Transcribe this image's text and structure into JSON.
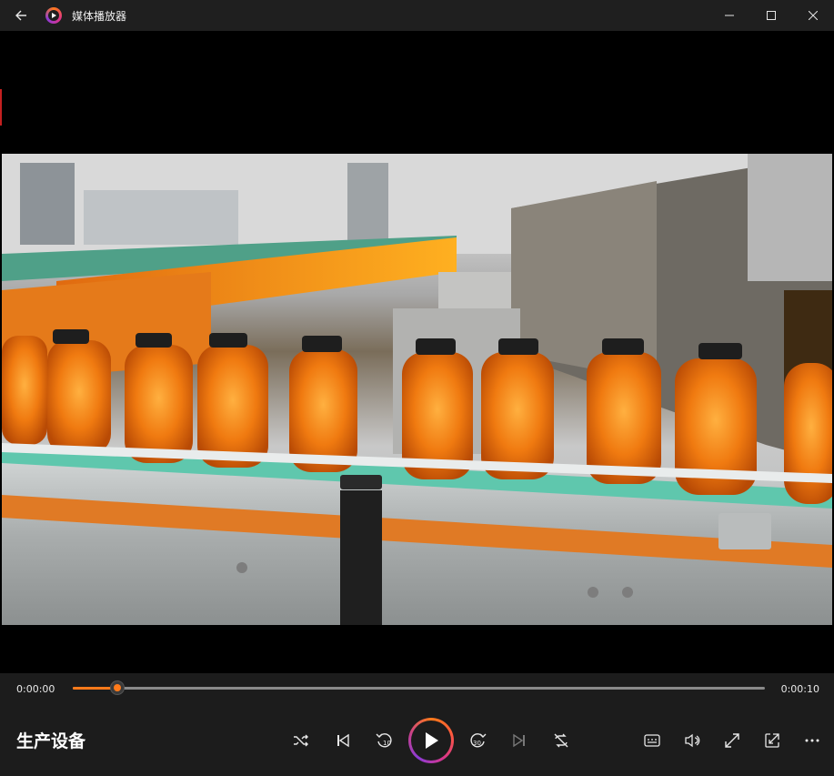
{
  "window": {
    "app_title": "媒体播放器",
    "icons": {
      "back": "arrow-left-icon",
      "minimize": "minimize-icon",
      "maximize": "maximize-icon",
      "close": "close-icon"
    }
  },
  "player": {
    "current_time": "0:00:00",
    "duration": "0:00:10",
    "progress_fraction": 0.065,
    "media_title": "生产设备",
    "accent_color": "#ff7a1a",
    "controls": [
      {
        "name": "shuffle",
        "icon": "shuffle-icon"
      },
      {
        "name": "previous",
        "icon": "skip-previous-icon"
      },
      {
        "name": "skip-back",
        "icon": "rewind-10-icon",
        "label": "10"
      },
      {
        "name": "play",
        "icon": "play-icon"
      },
      {
        "name": "skip-forward",
        "icon": "forward-30-icon",
        "label": "30"
      },
      {
        "name": "next",
        "icon": "skip-next-icon",
        "disabled": true
      },
      {
        "name": "repeat",
        "icon": "repeat-off-icon"
      }
    ],
    "right_controls": [
      {
        "name": "captions",
        "icon": "captions-icon"
      },
      {
        "name": "volume",
        "icon": "volume-icon"
      },
      {
        "name": "fullscreen",
        "icon": "fullscreen-icon"
      },
      {
        "name": "mini-player",
        "icon": "mini-player-icon"
      },
      {
        "name": "more",
        "icon": "more-icon"
      }
    ]
  }
}
